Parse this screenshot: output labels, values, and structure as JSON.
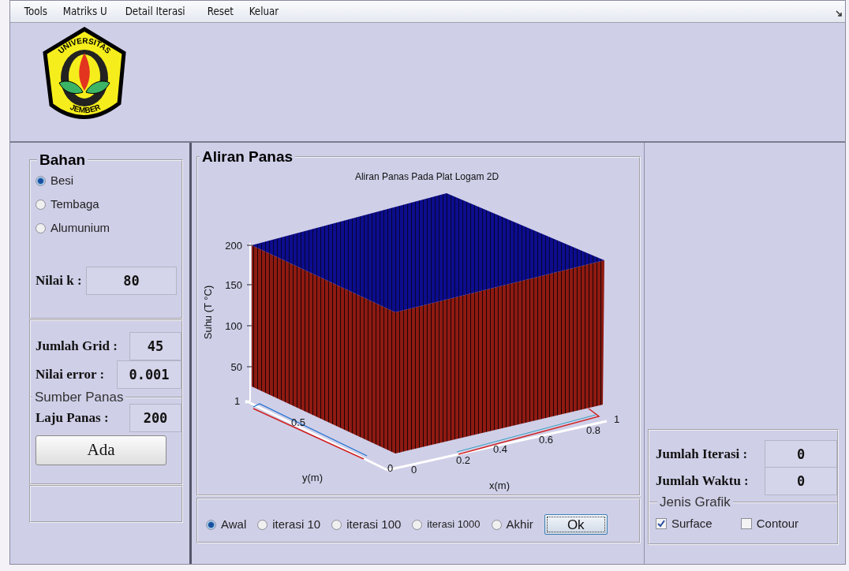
{
  "menu": [
    "Tools",
    "Matriks U",
    "Detail Iterasi",
    "Reset",
    "Keluar"
  ],
  "logo": {
    "top_text": "UNIVERSITAS",
    "bottom_text": "JEMBER"
  },
  "bahan": {
    "title": "Bahan",
    "options": [
      {
        "label": "Besi",
        "selected": true
      },
      {
        "label": "Tembaga",
        "selected": false
      },
      {
        "label": "Alumunium",
        "selected": false
      }
    ],
    "k_label": "Nilai k :",
    "k_value": "80"
  },
  "grid": {
    "label": "Jumlah Grid :",
    "value": "45"
  },
  "error": {
    "label": "Nilai error :",
    "value": "0.001"
  },
  "sumber_panas": {
    "title": "Sumber Panas",
    "label": "Laju Panas :",
    "value": "200",
    "button": "Ada"
  },
  "aliran_panas": {
    "title": "Aliran Panas",
    "plot": {
      "title": "Aliran Panas Pada Plat Logam 2D",
      "zlabel": "Suhu (T °C)",
      "xlabel": "x(m)",
      "ylabel": "y(m)",
      "zticks": [
        "200",
        "150",
        "100",
        "50"
      ],
      "xticks": [
        "0",
        "0.2",
        "0.4",
        "0.6",
        "0.8",
        "1"
      ],
      "yticks": [
        "0",
        "0.5",
        "1"
      ]
    },
    "options": [
      {
        "label": "Awal",
        "selected": true
      },
      {
        "label": "iterasi 10",
        "selected": false
      },
      {
        "label": "iterasi 100",
        "selected": false
      },
      {
        "label": "iterasi 1000",
        "selected": false
      },
      {
        "label": "Akhir",
        "selected": false
      }
    ],
    "ok_button": "Ok"
  },
  "results": [
    {
      "label": "Jumlah Iterasi :",
      "value": "0"
    },
    {
      "label": "Jumlah Waktu :",
      "value": "0"
    }
  ],
  "jenis_grafik": {
    "title": "Jenis Grafik",
    "options": [
      {
        "label": "Surface",
        "checked": true
      },
      {
        "label": "Contour",
        "checked": false
      }
    ]
  }
}
